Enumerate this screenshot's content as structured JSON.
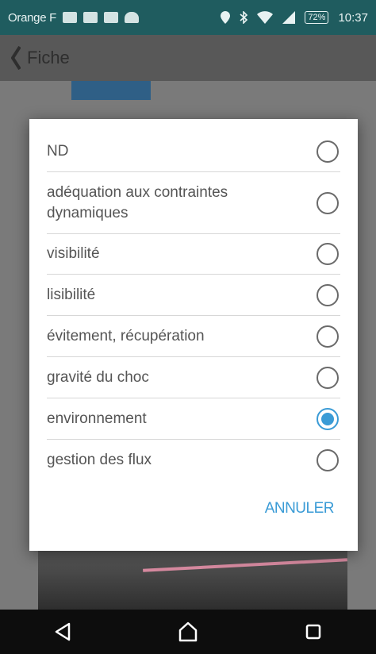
{
  "status_bar": {
    "carrier": "Orange F",
    "battery": "72%",
    "time": "10:37",
    "icons": [
      "notification-icon",
      "facebook-icon",
      "gallery-icon",
      "android-icon",
      "location-icon",
      "bluetooth-icon",
      "wifi-icon",
      "signal-icon"
    ]
  },
  "app": {
    "title": "Fiche"
  },
  "dialog": {
    "options": [
      {
        "label": "ND",
        "checked": false
      },
      {
        "label": "adéquation aux contraintes dynamiques",
        "checked": false
      },
      {
        "label": "visibilité",
        "checked": false
      },
      {
        "label": "lisibilité",
        "checked": false
      },
      {
        "label": "évitement, récupération",
        "checked": false
      },
      {
        "label": "gravité du choc",
        "checked": false
      },
      {
        "label": "environnement",
        "checked": true
      },
      {
        "label": "gestion des flux",
        "checked": false
      }
    ],
    "cancel_label": "ANNULER"
  },
  "colors": {
    "accent": "#3a9bd6",
    "status_bar": "#1f5c5f"
  }
}
